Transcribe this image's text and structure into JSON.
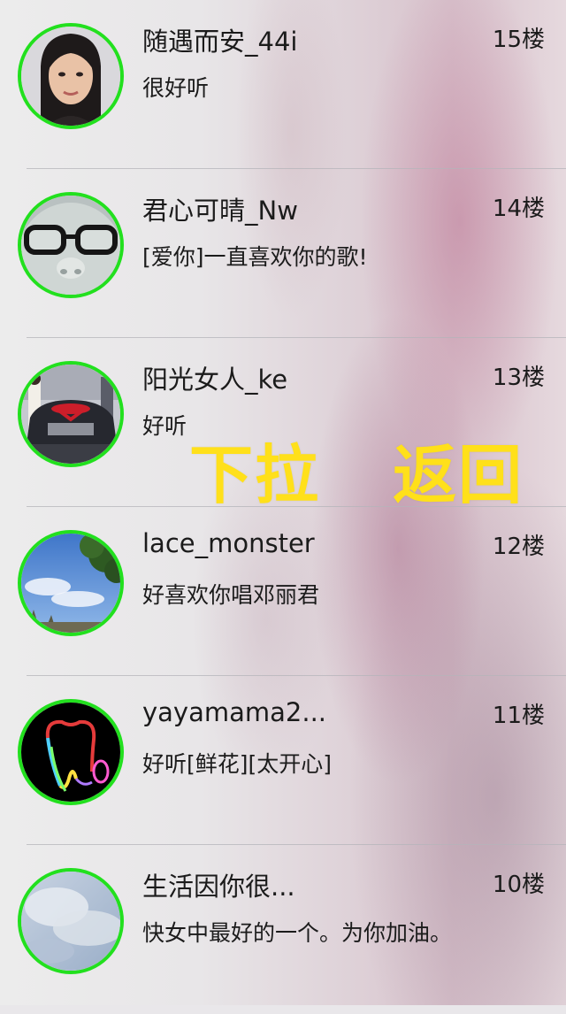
{
  "overlay": {
    "pull_down_label": "下拉",
    "back_label": "返回"
  },
  "comments": [
    {
      "username": "随遇而安_44i",
      "floor": "15楼",
      "text": "很好听",
      "avatar_icon": "portrait-woman"
    },
    {
      "username": "君心可晴_Nw",
      "floor": "14楼",
      "text": "[爱你]一直喜欢你的歌!",
      "avatar_icon": "face-with-glasses"
    },
    {
      "username": "阳光女人_ke",
      "floor": "13楼",
      "text": "好听",
      "avatar_icon": "car-with-ribbon"
    },
    {
      "username": "lace_monster",
      "floor": "12楼",
      "text": "好喜欢你唱邓丽君",
      "avatar_icon": "sky-and-tree"
    },
    {
      "username": "yayamama2...",
      "floor": "11楼",
      "text": "好听[鲜花][太开心]",
      "avatar_icon": "neon-tooth"
    },
    {
      "username": "生活因你很...",
      "floor": "10楼",
      "text": "快女中最好的一个。为你加油。",
      "avatar_icon": "cloudy-sky"
    }
  ],
  "colors": {
    "avatar_border": "#22e01e",
    "overlay_text": "#ffe01a",
    "text": "#1b1b1b"
  }
}
